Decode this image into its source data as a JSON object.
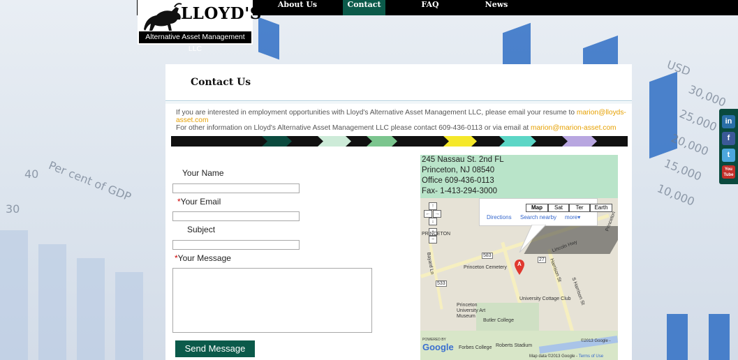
{
  "nav": {
    "items": [
      {
        "label": "About Us"
      },
      {
        "label": "Contact"
      },
      {
        "label": "FAQ"
      },
      {
        "label": "News"
      }
    ],
    "active": "Contact"
  },
  "logo": {
    "brand": "LLOYD'S",
    "tagline": "Alternative Asset Management LLC"
  },
  "page": {
    "title": "Contact Us",
    "intro_line1_prefix": "If you are interested in employment opportunities with Lloyd's Alternative Asset Management LLC, please email your resume to ",
    "intro_line1_email": "marion@lloyds-asset.com",
    "intro_line2_prefix": "For other information on Lloyd's Alternative Asset Management LLC please contact 609-436-0113 or via email at ",
    "intro_line2_email": "marion@marion-asset.com"
  },
  "form": {
    "name_label": "Your Name",
    "email_required": "*",
    "email_label": "Your  Email",
    "subject_label": "Subject",
    "message_required": "*",
    "message_label": "Your Message",
    "name_value": "",
    "email_value": "",
    "subject_value": "",
    "message_value": "",
    "send_label": "Send Message"
  },
  "address": {
    "line1": "245 Nassau St. 2nd FL",
    "line2": "Princeton, NJ 08540",
    "line3": "Office 609-436-0113",
    "line4": "Fax- 1-413-294-3000"
  },
  "map": {
    "type_buttons": [
      "Map",
      "Sat",
      "Ter",
      "Earth"
    ],
    "selected_type": "Map",
    "links": [
      "Directions",
      "Search nearby",
      "more▾"
    ],
    "labels": {
      "princeton_cemetery": "Princeton Cemetery",
      "university_cottage_club": "University Cottage Club",
      "princeton_art_museum": "Princeton University Art Museum",
      "butler_college": "Butler College",
      "forbes_college": "Forbes College",
      "roberts_stadium": "Roberts Stadium",
      "lincoln_hwy": "Lincoln Hwy",
      "harrison_st": "Harrison St",
      "s_harrison_st": "S Harrison St",
      "bayard_ln": "Bayard Ln",
      "princeton": "PRINCETON",
      "princeton_ave": "Princeton",
      "route_27": "27",
      "route_533": "533",
      "route_583": "583",
      "powered_by": "POWERED BY",
      "google": "Google",
      "copyright": "©2013 Google -",
      "map_data": "Map data ©2013 Google - ",
      "terms": "Terms of Use"
    },
    "marker": "A"
  },
  "social": [
    "in",
    "f",
    "t",
    "You Tube"
  ],
  "colors": {
    "nav_bg": "#000000",
    "nav_active": "#0b5a4a",
    "link": "#e6a000",
    "address_bg": "#b9e4c9",
    "button": "#0b5a4a"
  },
  "background_text": {
    "gdp": "Per cent of GDP",
    "n40": "40",
    "n30": "30",
    "usd": "USD",
    "t1": "30,000",
    "t2": "25,000",
    "t3": "20,000",
    "t4": "15,000",
    "t5": "10,000"
  }
}
